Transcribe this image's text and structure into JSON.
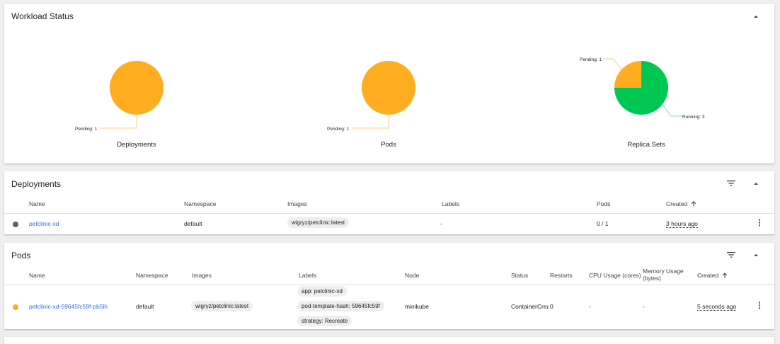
{
  "workload": {
    "title": "Workload Status",
    "charts": [
      {
        "label": "Deployments",
        "slices": [
          {
            "name": "Pending",
            "value": 1,
            "color": "#ffad20",
            "callout": "Pending: 1"
          }
        ]
      },
      {
        "label": "Pods",
        "slices": [
          {
            "name": "Pending",
            "value": 1,
            "color": "#ffad20",
            "callout": "Pending: 1"
          }
        ]
      },
      {
        "label": "Replica Sets",
        "slices": [
          {
            "name": "Running",
            "value": 3,
            "color": "#00c752",
            "callout": "Running: 3"
          },
          {
            "name": "Pending",
            "value": 1,
            "color": "#ffad20",
            "callout": "Pending: 1"
          }
        ]
      }
    ]
  },
  "deployments": {
    "title": "Deployments",
    "columns": {
      "name": "Name",
      "namespace": "Namespace",
      "images": "Images",
      "labels": "Labels",
      "pods": "Pods",
      "created": "Created"
    },
    "rows": [
      {
        "status_color": "#616161",
        "name": "petclinic-xd",
        "namespace": "default",
        "image": "wigryz/petclinic:latest",
        "labels": "-",
        "pods": "0 / 1",
        "created": "3 hours ago"
      }
    ]
  },
  "pods": {
    "title": "Pods",
    "columns": {
      "name": "Name",
      "namespace": "Namespace",
      "images": "Images",
      "labels": "Labels",
      "node": "Node",
      "status": "Status",
      "restarts": "Restarts",
      "cpu": "CPU Usage (cores)",
      "memory_1": "Memory Usage",
      "memory_2": "(bytes)",
      "created": "Created"
    },
    "rows": [
      {
        "status_color": "#ffad20",
        "name": "petclinic-xd-59645fc59f-pb5lh",
        "namespace": "default",
        "image": "wigryz/petclinic:latest",
        "labels": [
          "app: petclinic-xd",
          "pod-template-hash: 59645fc59f",
          "strategy: Recreate"
        ],
        "node": "minikube",
        "status": "ContainerCreating",
        "restarts": "0",
        "cpu": "-",
        "memory": "-",
        "created": "5 seconds ago"
      }
    ]
  },
  "icons": {
    "collapse": "chevron-up-icon",
    "filter": "filter-icon",
    "sort": "arrow-up-icon",
    "more": "more-vert-icon"
  }
}
